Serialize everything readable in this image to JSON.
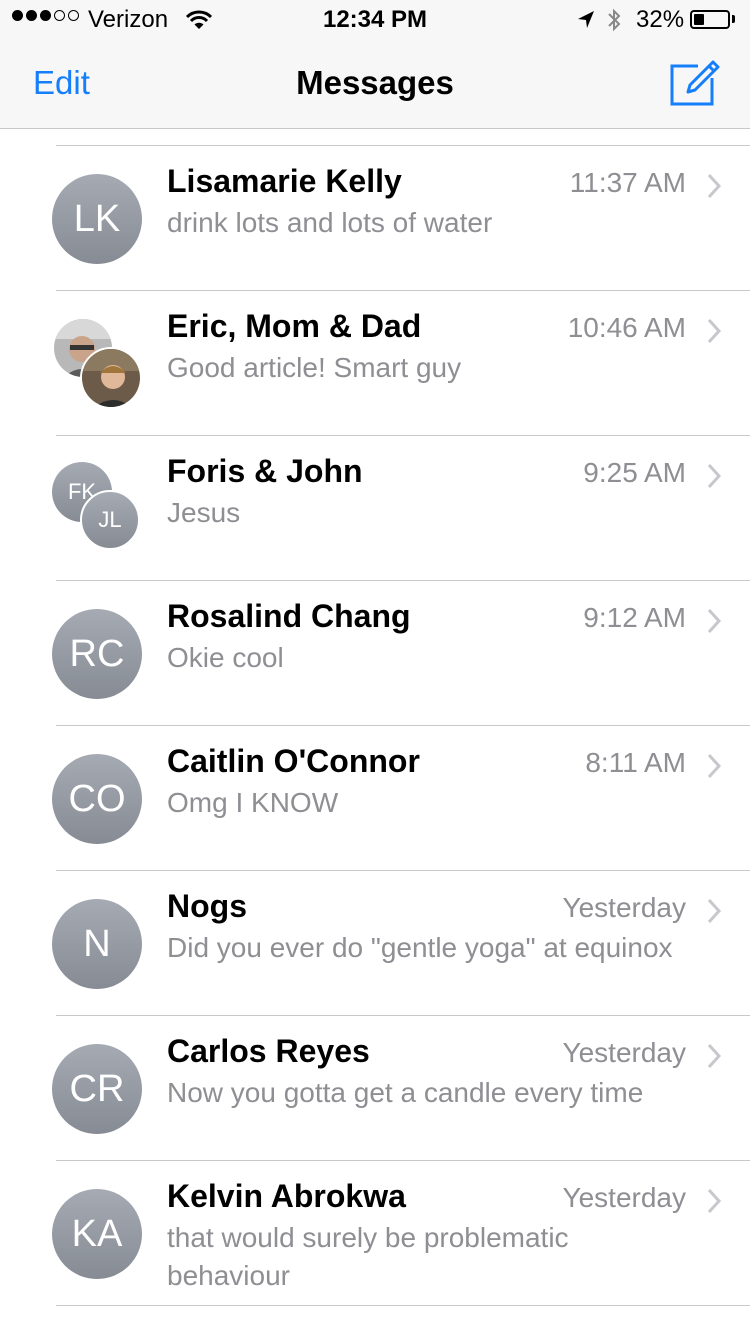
{
  "status": {
    "signal_filled": 3,
    "signal_total": 5,
    "carrier": "Verizon",
    "time": "12:34 PM",
    "battery_pct_label": "32%",
    "battery_level": 0.32
  },
  "nav": {
    "edit": "Edit",
    "title": "Messages",
    "compose_icon": "compose-icon",
    "accent": "#147efb"
  },
  "conversations": [
    {
      "initials": "LK",
      "name": "Lisamarie Kelly",
      "time": "11:37 AM",
      "preview": "drink lots and lots of water"
    },
    {
      "name": "Eric, Mom & Dad",
      "time": "10:46 AM",
      "preview": "Good article! Smart guy",
      "avatar": "group-photo"
    },
    {
      "initials": [
        "FK",
        "JL"
      ],
      "name": "Foris & John",
      "time": "9:25 AM",
      "preview": "Jesus"
    },
    {
      "initials": "RC",
      "name": "Rosalind Chang",
      "time": "9:12 AM",
      "preview": "Okie cool"
    },
    {
      "initials": "CO",
      "name": "Caitlin O'Connor",
      "time": "8:11 AM",
      "preview": "Omg I KNOW"
    },
    {
      "initials": "N",
      "name": "Nogs",
      "time": "Yesterday",
      "preview": "Did you ever do \"gentle yoga\" at equinox"
    },
    {
      "initials": "CR",
      "name": "Carlos Reyes",
      "time": "Yesterday",
      "preview": "Now you gotta get a candle every time"
    },
    {
      "initials": "KA",
      "name": "Kelvin Abrokwa",
      "time": "Yesterday",
      "preview": "that would surely be problematic behaviour"
    }
  ]
}
